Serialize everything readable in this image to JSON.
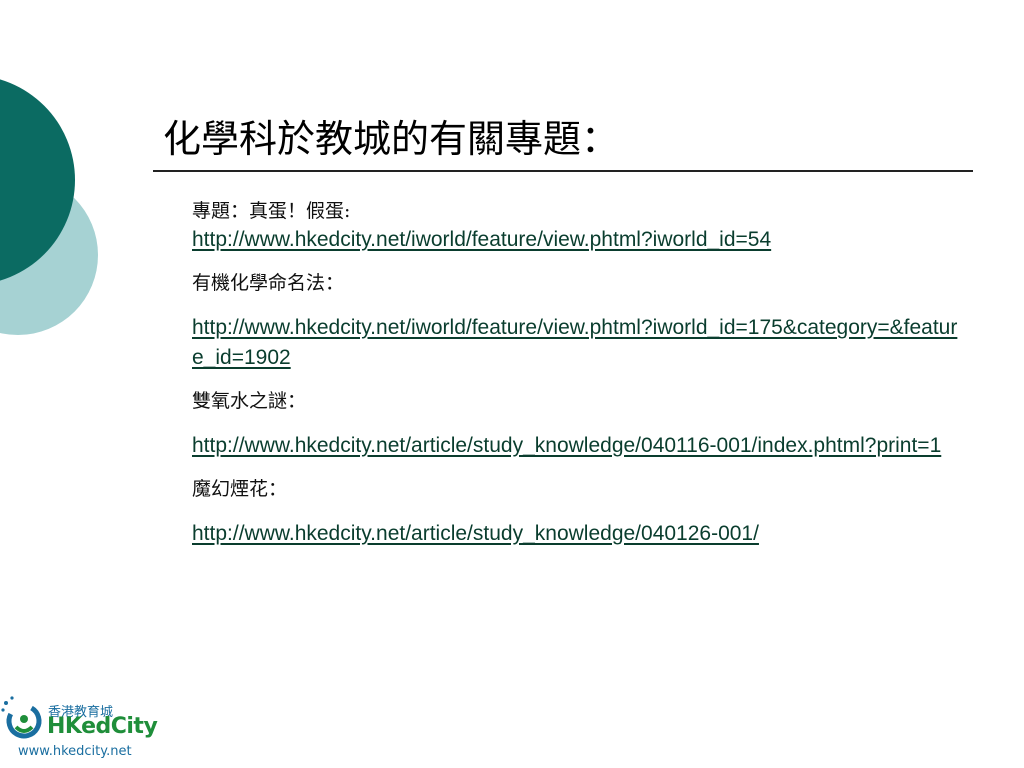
{
  "slide": {
    "title": "化學科於教城的有關專題：",
    "items": [
      {
        "label": "專題：真蛋！假蛋:",
        "url": "http://www.hkedcity.net/iworld/feature/view.phtml?iworld_id=54"
      },
      {
        "label": "有機化學命名法：",
        "url": "http://www.hkedcity.net/iworld/feature/view.phtml?iworld_id=175&category=&feature_id=1902"
      },
      {
        "label": "雙氧水之謎：",
        "url": "http://www.hkedcity.net/article/study_knowledge/040116-001/index.phtml?print=1"
      },
      {
        "label": "魔幻煙花：",
        "url": "http://www.hkedcity.net/article/study_knowledge/040126-001/"
      }
    ]
  },
  "logo": {
    "chinese": "香港教育城",
    "english": "HKedCity",
    "website": "www.hkedcity.net"
  },
  "colors": {
    "dark_teal": "#0b6b62",
    "light_teal": "#a6d2d3",
    "link": "#0a3d2e"
  }
}
